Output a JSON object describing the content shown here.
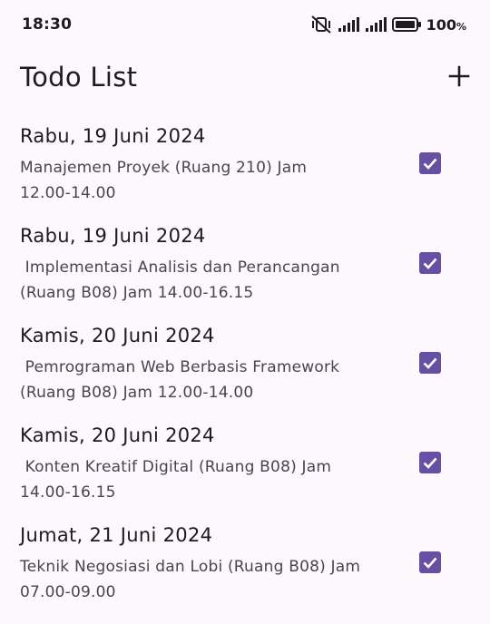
{
  "status_bar": {
    "time": "18:30",
    "battery_level": "100",
    "battery_unit": "%",
    "icons": [
      "mute-vibrate-icon",
      "signal-icon",
      "signal-icon",
      "battery-icon"
    ]
  },
  "app_bar": {
    "title": "Todo List",
    "add_icon": "plus-icon"
  },
  "todos": [
    {
      "date": "Rabu, 19 Juni 2024",
      "description": "Manajemen Proyek (Ruang 210) Jam\n12.00-14.00",
      "checked": true
    },
    {
      "date": "Rabu, 19 Juni 2024",
      "description": " Implementasi Analisis dan Perancangan\n(Ruang B08) Jam 14.00-16.15",
      "checked": true
    },
    {
      "date": "Kamis, 20 Juni 2024",
      "description": " Pemrograman Web Berbasis Framework\n(Ruang B08) Jam 12.00-14.00",
      "checked": true
    },
    {
      "date": "Kamis, 20 Juni 2024",
      "description": " Konten Kreatif Digital (Ruang B08) Jam\n14.00-16.15",
      "checked": true
    },
    {
      "date": "Jumat, 21 Juni 2024",
      "description": "Teknik Negosiasi dan Lobi (Ruang B08) Jam\n07.00-09.00",
      "checked": true
    }
  ],
  "colors": {
    "accent": "#6750a4",
    "background": "#fdf7fe",
    "text_primary": "#1d1b20",
    "text_secondary": "#49454f"
  }
}
